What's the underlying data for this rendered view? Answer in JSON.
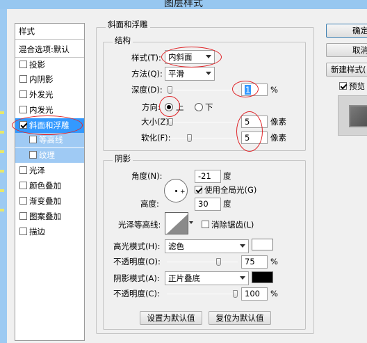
{
  "window": {
    "title": "图层样式"
  },
  "style_list": {
    "header": "样式",
    "blend_options": "混合选项:默认",
    "items": [
      {
        "label": "投影",
        "checked": false
      },
      {
        "label": "内阴影",
        "checked": false
      },
      {
        "label": "外发光",
        "checked": false
      },
      {
        "label": "内发光",
        "checked": false
      },
      {
        "label": "斜面和浮雕",
        "checked": true,
        "selected": true
      },
      {
        "label": "等高线",
        "checked": false,
        "sub": true
      },
      {
        "label": "纹理",
        "checked": false,
        "sub": true
      },
      {
        "label": "光泽",
        "checked": false
      },
      {
        "label": "颜色叠加",
        "checked": false
      },
      {
        "label": "渐变叠加",
        "checked": false
      },
      {
        "label": "图案叠加",
        "checked": false
      },
      {
        "label": "描边",
        "checked": false
      }
    ]
  },
  "bevel": {
    "section_title": "斜面和浮雕",
    "structure": {
      "title": "结构",
      "style_label": "样式(T):",
      "style_value": "内斜面",
      "method_label": "方法(Q):",
      "method_value": "平滑",
      "depth_label": "深度(D):",
      "depth_value": "1",
      "depth_unit": "%",
      "depth_level": 0.01,
      "direction_label": "方向:",
      "direction_up": "上",
      "direction_down": "下",
      "size_label": "大小(Z):",
      "size_value": "5",
      "size_unit": "像素",
      "size_level": 0.02,
      "soften_label": "软化(F):",
      "soften_value": "5",
      "soften_unit": "像素",
      "soften_level": 0.31
    },
    "shading": {
      "title": "阴影",
      "angle_label": "角度(N):",
      "angle_value": "-21",
      "angle_unit": "度",
      "global_light_label": "使用全局光(G)",
      "altitude_label": "高度:",
      "altitude_value": "30",
      "altitude_unit": "度",
      "gloss_label": "光泽等高线:",
      "antialias_label": "消除锯齿(L)",
      "highlight_mode_label": "高光模式(H):",
      "highlight_mode_value": "滤色",
      "highlight_color": "#ffffff",
      "highlight_opacity_label": "不透明度(O):",
      "highlight_opacity_value": "75",
      "highlight_opacity_level": 0.75,
      "shadow_mode_label": "阴影模式(A):",
      "shadow_mode_value": "正片叠底",
      "shadow_color": "#000000",
      "shadow_opacity_label": "不透明度(C):",
      "shadow_opacity_value": "100",
      "shadow_opacity_level": 1.0,
      "percent": "%"
    },
    "make_default": "设置为默认值",
    "reset_default": "复位为默认值"
  },
  "actions": {
    "ok": "确定",
    "cancel": "取消",
    "new_style": "新建样式(",
    "preview": "预览"
  },
  "colors": {
    "selection": "#3399ff",
    "sub_selection": "#9fcaf4",
    "annotation": "#e0262a"
  }
}
